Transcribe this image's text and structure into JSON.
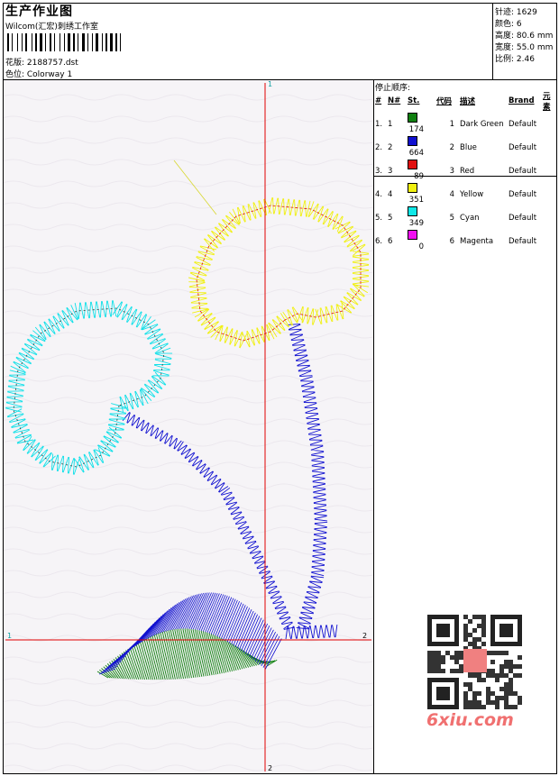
{
  "header": {
    "title": "生产作业图",
    "subtitle": "Wilcom(汇宏)刺绣工作室",
    "file_label": "花版: 2188757.dst",
    "colorway_label": "色位: Colorway 1"
  },
  "stats": [
    {
      "label": "针迹:",
      "value": "1629"
    },
    {
      "label": "颜色:",
      "value": "6"
    },
    {
      "label": "高度:",
      "value": "80.6 mm"
    },
    {
      "label": "宽度:",
      "value": "55.0 mm"
    },
    {
      "label": "比例:",
      "value": "2.46"
    }
  ],
  "stop_sequence": {
    "title": "停止顺序:",
    "headers": [
      "#",
      "N#",
      "St.",
      "代码",
      "描述",
      "Brand",
      "元素"
    ],
    "rows": [
      {
        "idx": "1.",
        "n": "1",
        "color": "#108010",
        "stitches": "174",
        "code": "1",
        "desc": "Dark Green",
        "brand": "Default"
      },
      {
        "idx": "2.",
        "n": "2",
        "color": "#1010d0",
        "stitches": "664",
        "code": "2",
        "desc": "Blue",
        "brand": "Default"
      },
      {
        "idx": "3.",
        "n": "3",
        "color": "#e01010",
        "stitches": "89",
        "code": "3",
        "desc": "Red",
        "brand": "Default"
      },
      {
        "idx": "4.",
        "n": "4",
        "color": "#f0f010",
        "stitches": "351",
        "code": "4",
        "desc": "Yellow",
        "brand": "Default"
      },
      {
        "idx": "5.",
        "n": "5",
        "color": "#10e8e8",
        "stitches": "349",
        "code": "5",
        "desc": "Cyan",
        "brand": "Default"
      },
      {
        "idx": "6.",
        "n": "6",
        "color": "#f010f0",
        "stitches": "0",
        "code": "6",
        "desc": "Magenta",
        "brand": "Default"
      }
    ]
  },
  "axes": {
    "top": "1",
    "bottom": "2",
    "left": "1",
    "right": "2"
  },
  "watermark": {
    "site": "6xiu.com"
  },
  "colors": {
    "axis": "#e00000",
    "cyan": "#10e0e8",
    "yellow": "#f0f010",
    "blue": "#1010d0",
    "green": "#108010",
    "red": "#e01010"
  }
}
